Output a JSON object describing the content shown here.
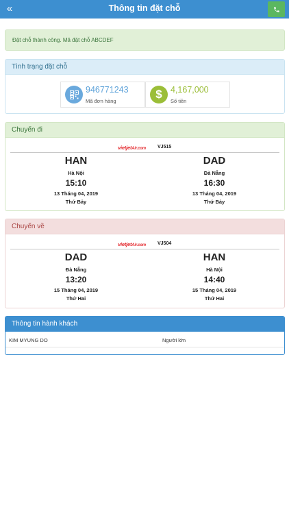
{
  "header": {
    "title": "Thông tin đặt chỗ",
    "back_icon": "chevron-double-left-icon",
    "phone_icon": "phone-icon",
    "color": "#3d8fd0",
    "phone_color": "#5bb760"
  },
  "alert": {
    "message": "Đặt chỗ thành công. Mã đặt chỗ ABCDEF"
  },
  "status": {
    "title": "Tình trạng đặt chỗ",
    "order_number": "946771243",
    "order_label": "Mã đơn hàng",
    "amount": "4,167,000",
    "amount_label": "Số tiền",
    "amount_icon": "$"
  },
  "departure": {
    "title": "Chuyến đi",
    "airline_logo": "vietjetAir.com",
    "flight_number": "VJ515",
    "from": {
      "code": "HAN",
      "city": "Hà Nội",
      "time": "15:10",
      "date": "13 Tháng 04, 2019",
      "weekday": "Thứ Bảy"
    },
    "to": {
      "code": "DAD",
      "city": "Đà Nẵng",
      "time": "16:30",
      "date": "13 Tháng 04, 2019",
      "weekday": "Thứ Bảy"
    }
  },
  "return": {
    "title": "Chuyến về",
    "airline_logo": "vietjetAir.com",
    "flight_number": "VJ504",
    "from": {
      "code": "DAD",
      "city": "Đà Nẵng",
      "time": "13:20",
      "date": "15 Tháng 04, 2019",
      "weekday": "Thứ Hai"
    },
    "to": {
      "code": "HAN",
      "city": "Hà Nội",
      "time": "14:40",
      "date": "15 Tháng 04, 2019",
      "weekday": "Thứ Hai"
    }
  },
  "passengers": {
    "title": "Thông tin hành khách",
    "rows": [
      {
        "name": "KIM MYUNG DO",
        "type": "Người lớn"
      }
    ]
  }
}
